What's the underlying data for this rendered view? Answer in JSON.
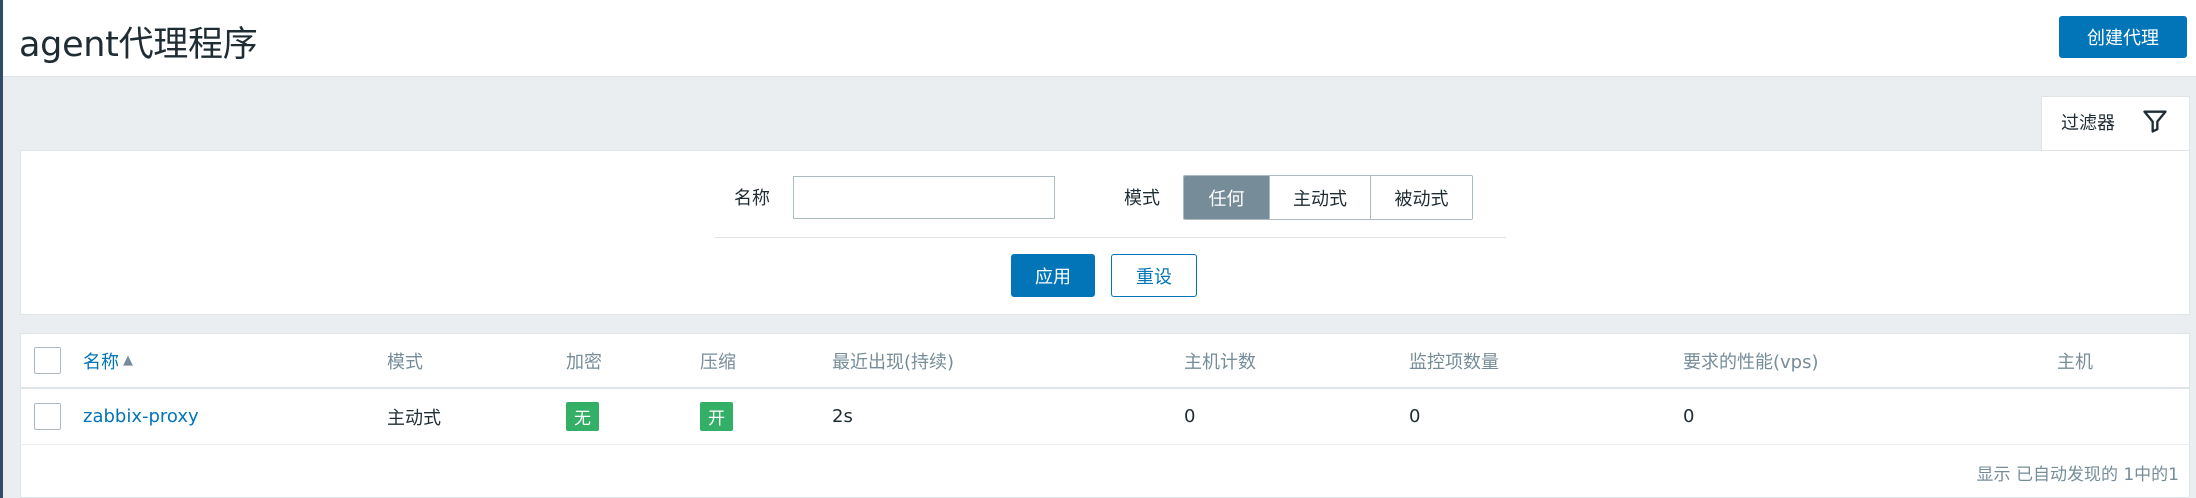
{
  "header": {
    "title": "agent代理程序",
    "create_button": "创建代理"
  },
  "filter": {
    "tab_label": "过滤器",
    "tab_icon": "filter-funnel-icon",
    "name_label": "名称",
    "name_value": "",
    "mode_label": "模式",
    "mode_options": [
      "任何",
      "主动式",
      "被动式"
    ],
    "mode_selected": "任何",
    "apply_button": "应用",
    "reset_button": "重设"
  },
  "table": {
    "columns": [
      "名称",
      "模式",
      "加密",
      "压缩",
      "最近出现(持续)",
      "主机计数",
      "监控项数量",
      "要求的性能(vps)",
      "主机"
    ],
    "sort_indicator": "▲",
    "rows": [
      {
        "name": "zabbix-proxy",
        "mode": "主动式",
        "encryption": "无",
        "compression": "开",
        "last_seen": "2s",
        "host_count": "0",
        "item_count": "0",
        "required_performance": "0",
        "hosts": ""
      }
    ],
    "footer": "显示 已自动发现的 1中的1"
  },
  "colors": {
    "primary": "#0275b8",
    "badge_green": "#34af67",
    "mode_active": "#768d99",
    "background": "#ebeef0"
  }
}
